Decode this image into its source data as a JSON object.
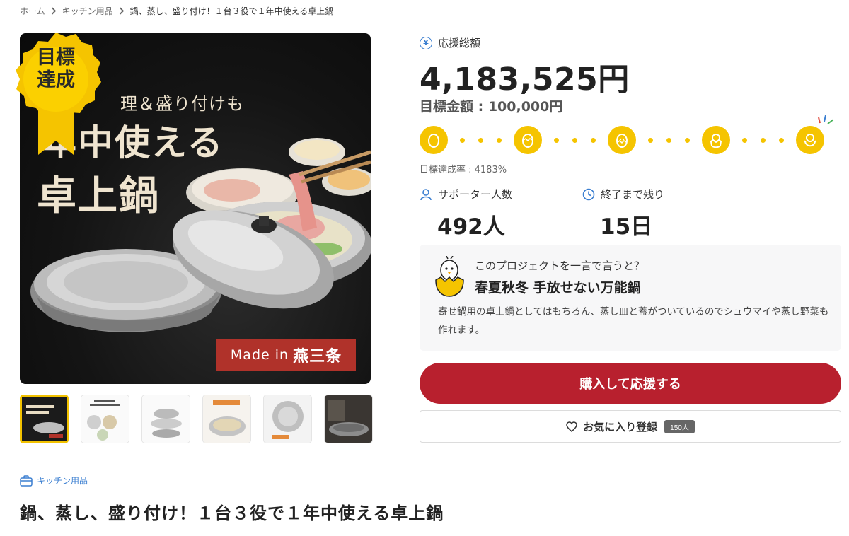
{
  "breadcrumb": {
    "items": [
      "ホーム",
      "キッチン用品",
      "鍋、蒸し、盛り付け！１台３役で１年中使える卓上鍋"
    ]
  },
  "hero": {
    "line1": "理＆盛り付けも",
    "line2": "年中使える",
    "line3": "卓上鍋",
    "made_in_prefix": "Made in",
    "made_in_place": "燕三条",
    "badge_line1": "目標",
    "badge_line2": "達成"
  },
  "thumbnails": {
    "count": 6,
    "active_index": 0
  },
  "funding": {
    "total_label": "応援総額",
    "total_icon": "yen-icon",
    "total_amount": "4,183,525円",
    "goal_text": "目標金額 : 100,000円",
    "achievement_rate_text": "目標達成率 : 4183%",
    "progress_fraction": 1.0,
    "milestone_icons": [
      "egg-icon",
      "cracking-egg-icon",
      "hatching-egg-icon",
      "chick-in-shell-icon",
      "chick-icon"
    ]
  },
  "stats": {
    "supporters_label": "サポーター人数",
    "supporters_value": "492人",
    "remaining_label": "終了まで残り",
    "remaining_value": "15日"
  },
  "summary": {
    "question": "このプロジェクトを一言で言うと？",
    "title": "春夏秋冬 手放せない万能鍋",
    "body": "寄せ鍋用の卓上鍋としてはもちろん、蒸し皿と蓋がついているのでシュウマイや蒸し野菜も作れます。"
  },
  "actions": {
    "buy_label": "購入して応援する",
    "favorite_label": "お気に入り登録",
    "favorite_count": "150人"
  },
  "category": {
    "label": "キッチン用品"
  },
  "title": "鍋、蒸し、盛り付け！１台３役で１年中使える卓上鍋",
  "colors": {
    "accent_yellow": "#f5c400",
    "buy_red": "#b8202e",
    "link_blue": "#3b7fd1",
    "made_in_red": "#b0322a"
  }
}
